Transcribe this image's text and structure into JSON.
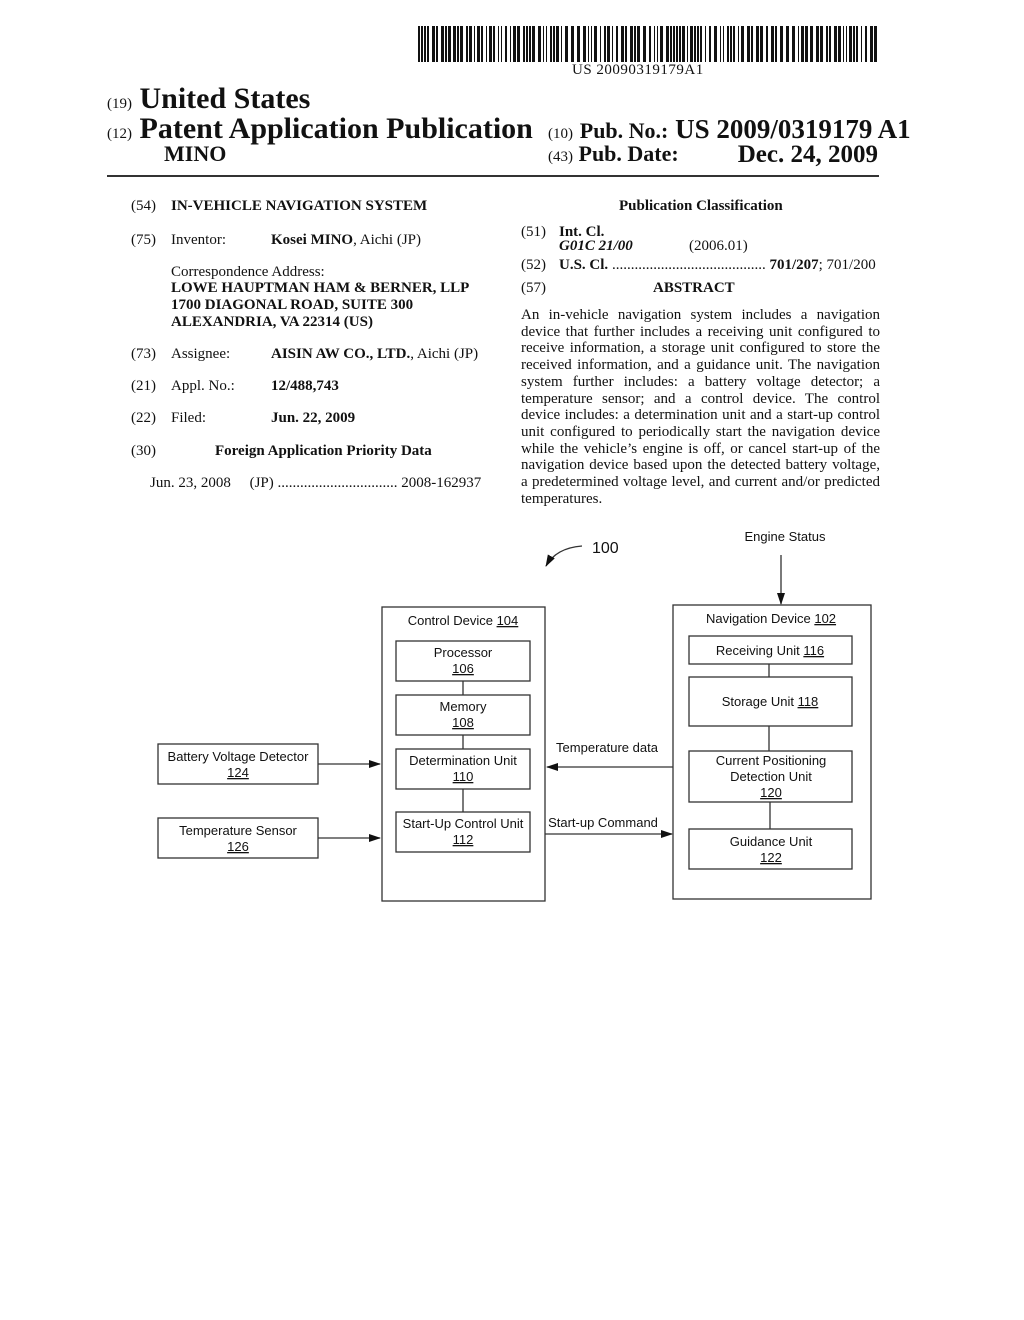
{
  "header": {
    "barcode_number": "US 20090319179A1",
    "inid_19": "(19)",
    "country": "United States",
    "inid_12": "(12)",
    "doc_type": "Patent Application Publication",
    "applicant_short": "MINO",
    "inid_10": "(10)",
    "pub_no_label": "Pub. No.:",
    "pub_no": "US 2009/0319179 A1",
    "inid_43": "(43)",
    "pub_date_label": "Pub. Date:",
    "pub_date": "Dec. 24, 2009"
  },
  "biblio": {
    "title_inid": "(54)",
    "title": "IN-VEHICLE NAVIGATION SYSTEM",
    "inventor_inid": "(75)",
    "inventor_label": "Inventor:",
    "inventor_name": "Kosei MINO",
    "inventor_loc": ", Aichi (JP)",
    "correspondence_label": "Correspondence Address:",
    "correspondence_lines": [
      "LOWE HAUPTMAN HAM & BERNER, LLP",
      "1700 DIAGONAL ROAD, SUITE 300",
      "ALEXANDRIA, VA 22314 (US)"
    ],
    "assignee_inid": "(73)",
    "assignee_label": "Assignee:",
    "assignee_name": "AISIN AW CO., LTD.",
    "assignee_loc": ", Aichi (JP)",
    "appl_inid": "(21)",
    "appl_label": "Appl. No.:",
    "appl_no": "12/488,743",
    "filed_inid": "(22)",
    "filed_label": "Filed:",
    "filed_date": "Jun. 22, 2009",
    "priority_inid": "(30)",
    "priority_heading": "Foreign Application Priority Data",
    "priority_date": "Jun. 23, 2008",
    "priority_country": "(JP)",
    "priority_dots": "................................",
    "priority_number": "2008-162937"
  },
  "classification": {
    "heading": "Publication Classification",
    "int_inid": "(51)",
    "int_label": "Int. Cl.",
    "int_code": "G01C 21/00",
    "int_version": "(2006.01)",
    "us_inid": "(52)",
    "us_label": "U.S. Cl.",
    "us_dots": ".........................................",
    "us_primary": "701/207",
    "us_secondary": "; 701/200"
  },
  "abstract": {
    "inid": "(57)",
    "heading": "ABSTRACT",
    "text": "An in-vehicle navigation system includes a navigation device that further includes a receiving unit configured to receive information, a storage unit configured to store the received information, and a guidance unit. The navigation system further includes: a battery voltage detector; a temperature sensor; and a control device. The control device includes: a determination unit and a start-up control unit configured to periodically start the navigation device while the vehicle’s engine is off, or cancel start-up of the navigation device based upon the detected battery voltage, a predetermined voltage level, and current and/or predicted temperatures."
  },
  "diagram": {
    "figure_ref": "100",
    "engine_status": "Engine Status",
    "temperature_data": "Temperature data",
    "startup_command": "Start-up Command",
    "control_device": {
      "label": "Control Device ",
      "ref": "104"
    },
    "processor": {
      "label": "Processor",
      "ref": "106"
    },
    "memory": {
      "label": "Memory",
      "ref": "108"
    },
    "determination": {
      "label": "Determination Unit",
      "ref": "110"
    },
    "startup_control": {
      "label": "Start-Up Control Unit",
      "ref": "112"
    },
    "navigation_device": {
      "label": "Navigation Device ",
      "ref": "102"
    },
    "receiving": {
      "label": "Receiving Unit ",
      "ref": "116"
    },
    "storage": {
      "label": "Storage Unit ",
      "ref": "118"
    },
    "positioning": {
      "label1": "Current Positioning",
      "label2": "Detection Unit",
      "ref": "120"
    },
    "guidance": {
      "label": "Guidance Unit",
      "ref": "122"
    },
    "battery": {
      "label": "Battery Voltage Detector",
      "ref": "124"
    },
    "temperature": {
      "label": "Temperature Sensor",
      "ref": "126"
    }
  }
}
